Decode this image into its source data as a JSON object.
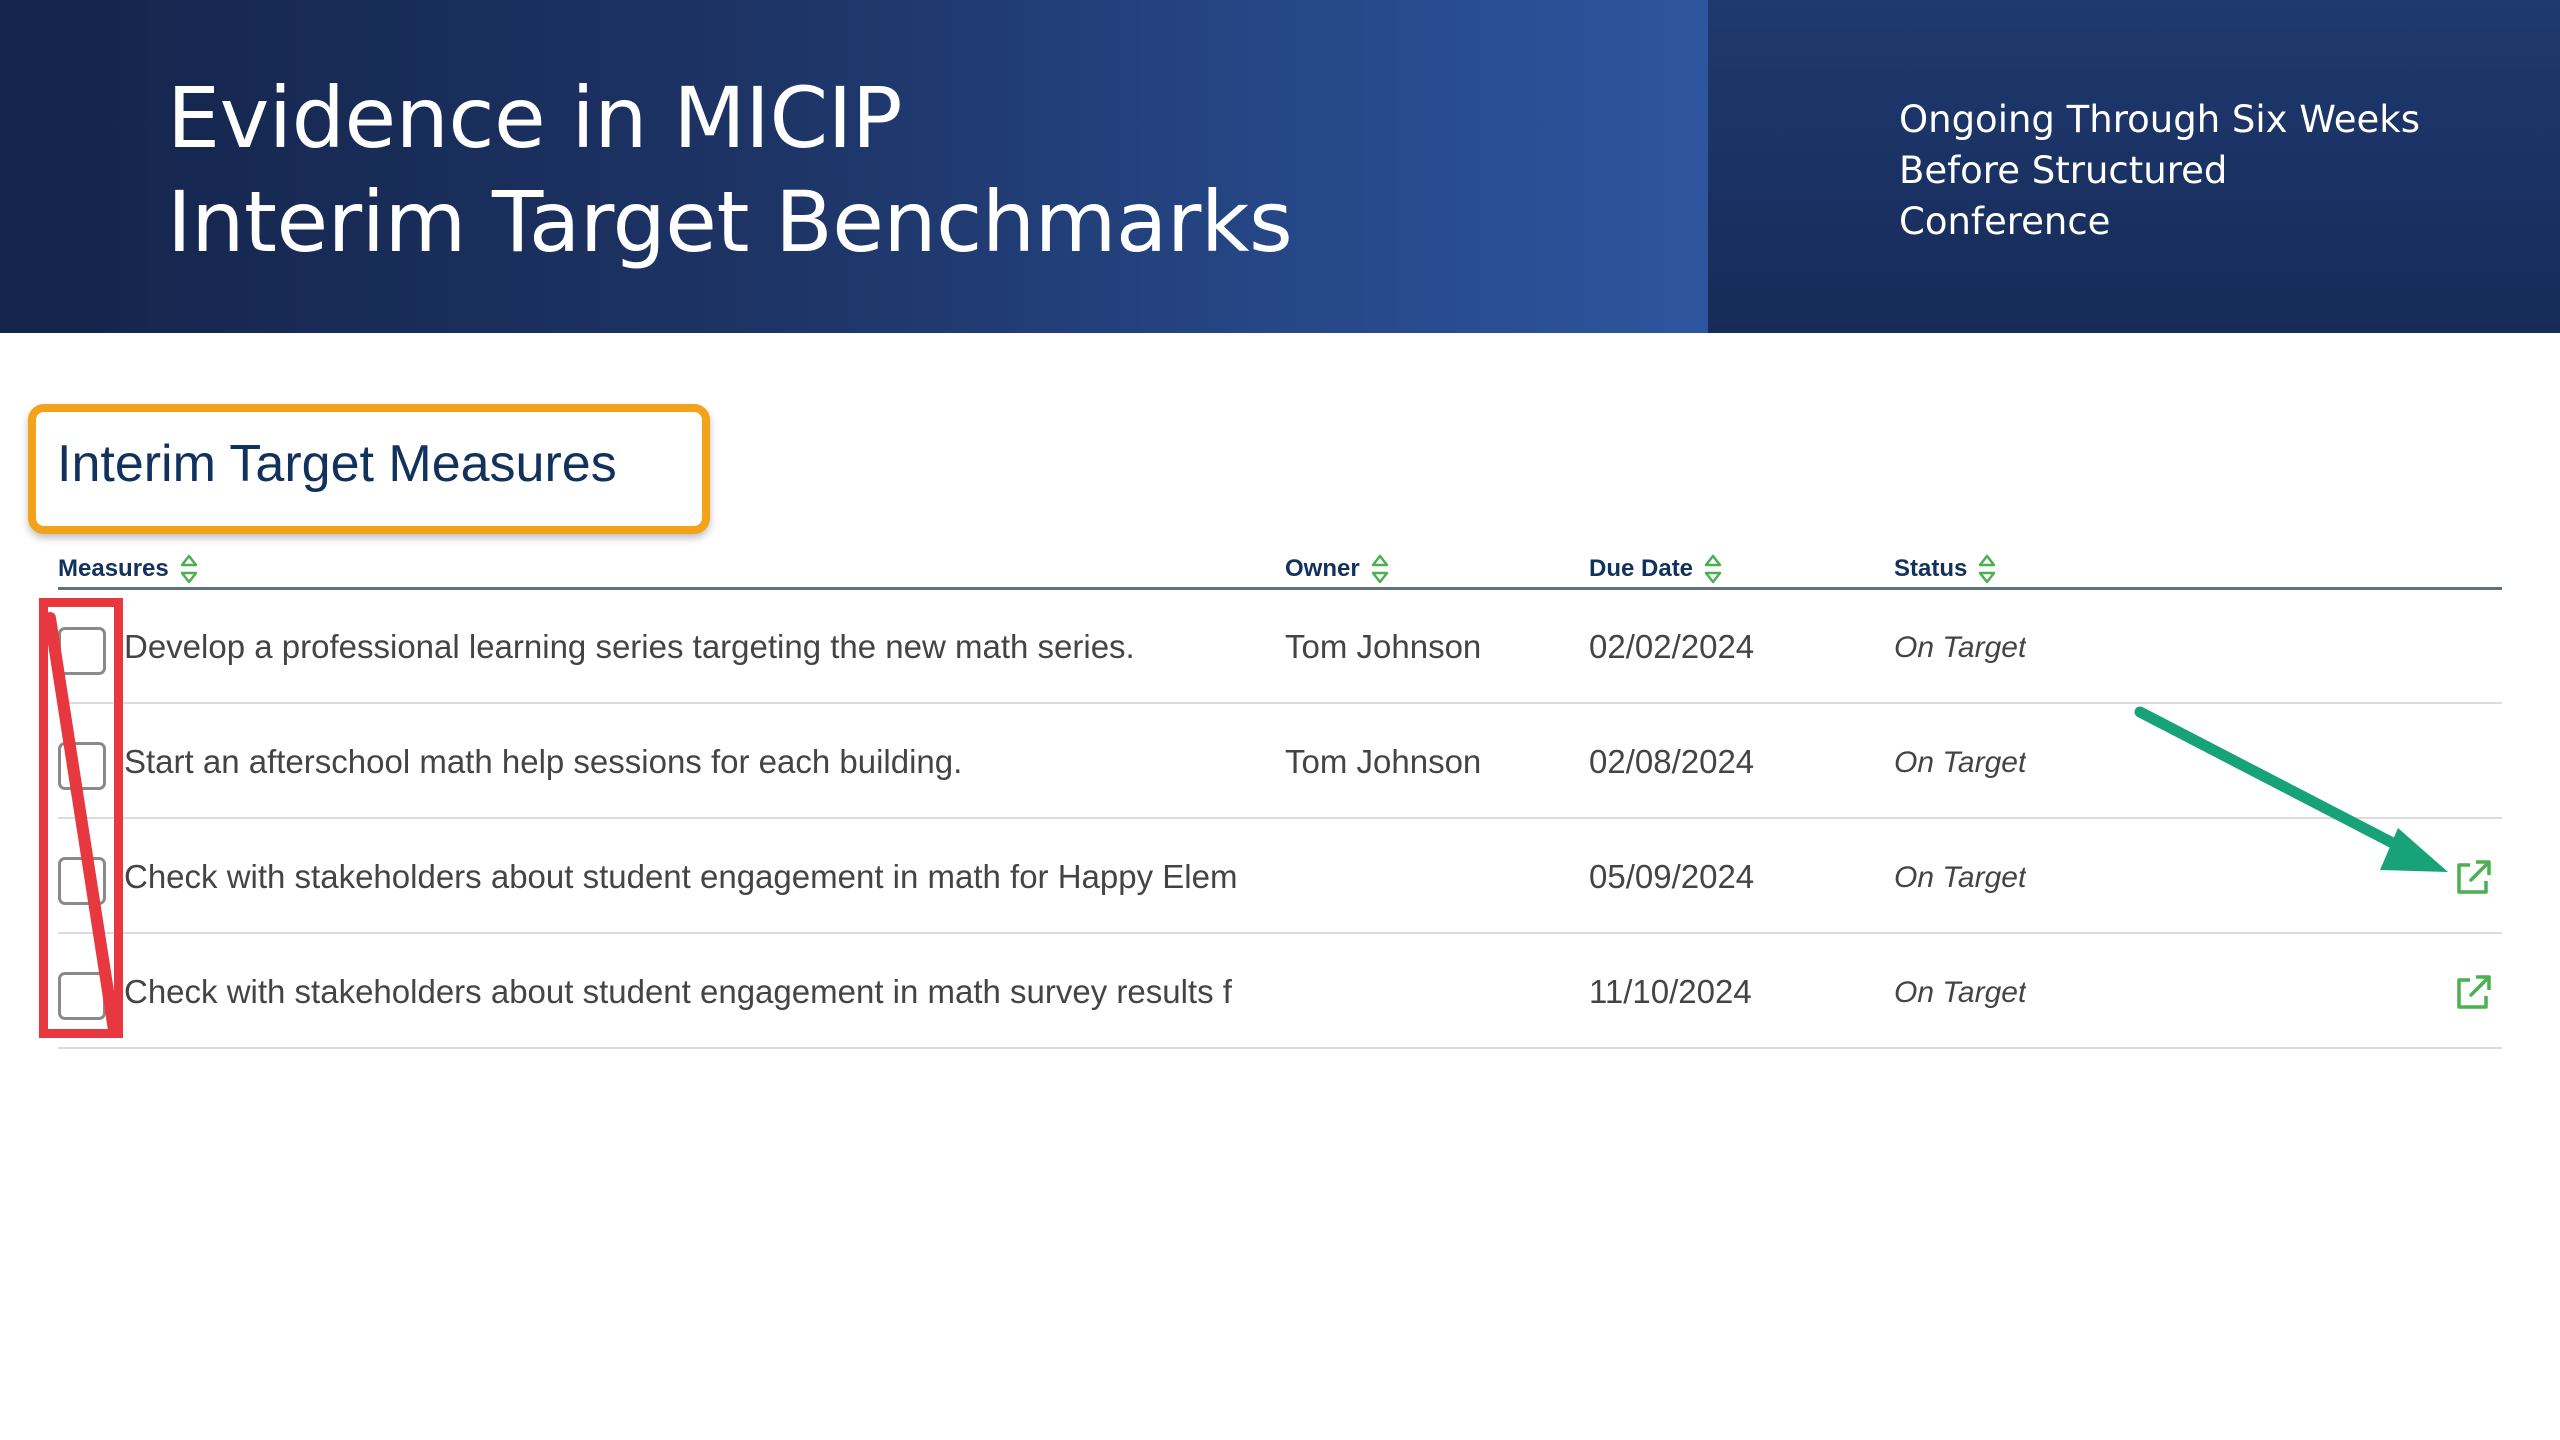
{
  "banner": {
    "title_line1": "Evidence in MICIP",
    "title_line2": "Interim Target Benchmarks",
    "subtitle_line1": "Ongoing Through Six Weeks",
    "subtitle_line2": "Before Structured",
    "subtitle_line3": "Conference"
  },
  "section": {
    "title": "Interim Target Measures"
  },
  "table": {
    "headers": {
      "measures": "Measures",
      "owner": "Owner",
      "due_date": "Due Date",
      "status": "Status"
    },
    "rows": [
      {
        "measure": "Develop a professional learning series targeting the new math series.",
        "owner": "Tom Johnson",
        "due_date": "02/02/2024",
        "status": "On Target",
        "has_link": false
      },
      {
        "measure": "Start an afterschool math help sessions for each building.",
        "owner": "Tom Johnson",
        "due_date": "02/08/2024",
        "status": "On Target",
        "has_link": false
      },
      {
        "measure": "Check with stakeholders about student engagement in math for Happy Elem",
        "owner": "",
        "due_date": "05/09/2024",
        "status": "On Target",
        "has_link": true
      },
      {
        "measure": "Check with stakeholders about student engagement in math survey results f",
        "owner": "",
        "due_date": "11/10/2024",
        "status": "On Target",
        "has_link": true
      }
    ]
  },
  "icons": {
    "sort": "sort-icon",
    "external_link": "external-link-icon"
  },
  "colors": {
    "banner_dark": "#14244a",
    "banner_light": "#2e56a0",
    "heading_text": "#12325e",
    "highlight_orange": "#f2a31b",
    "annotation_red": "#e8383f",
    "annotation_arrow": "#17a27a",
    "accent_green": "#4caf50"
  }
}
